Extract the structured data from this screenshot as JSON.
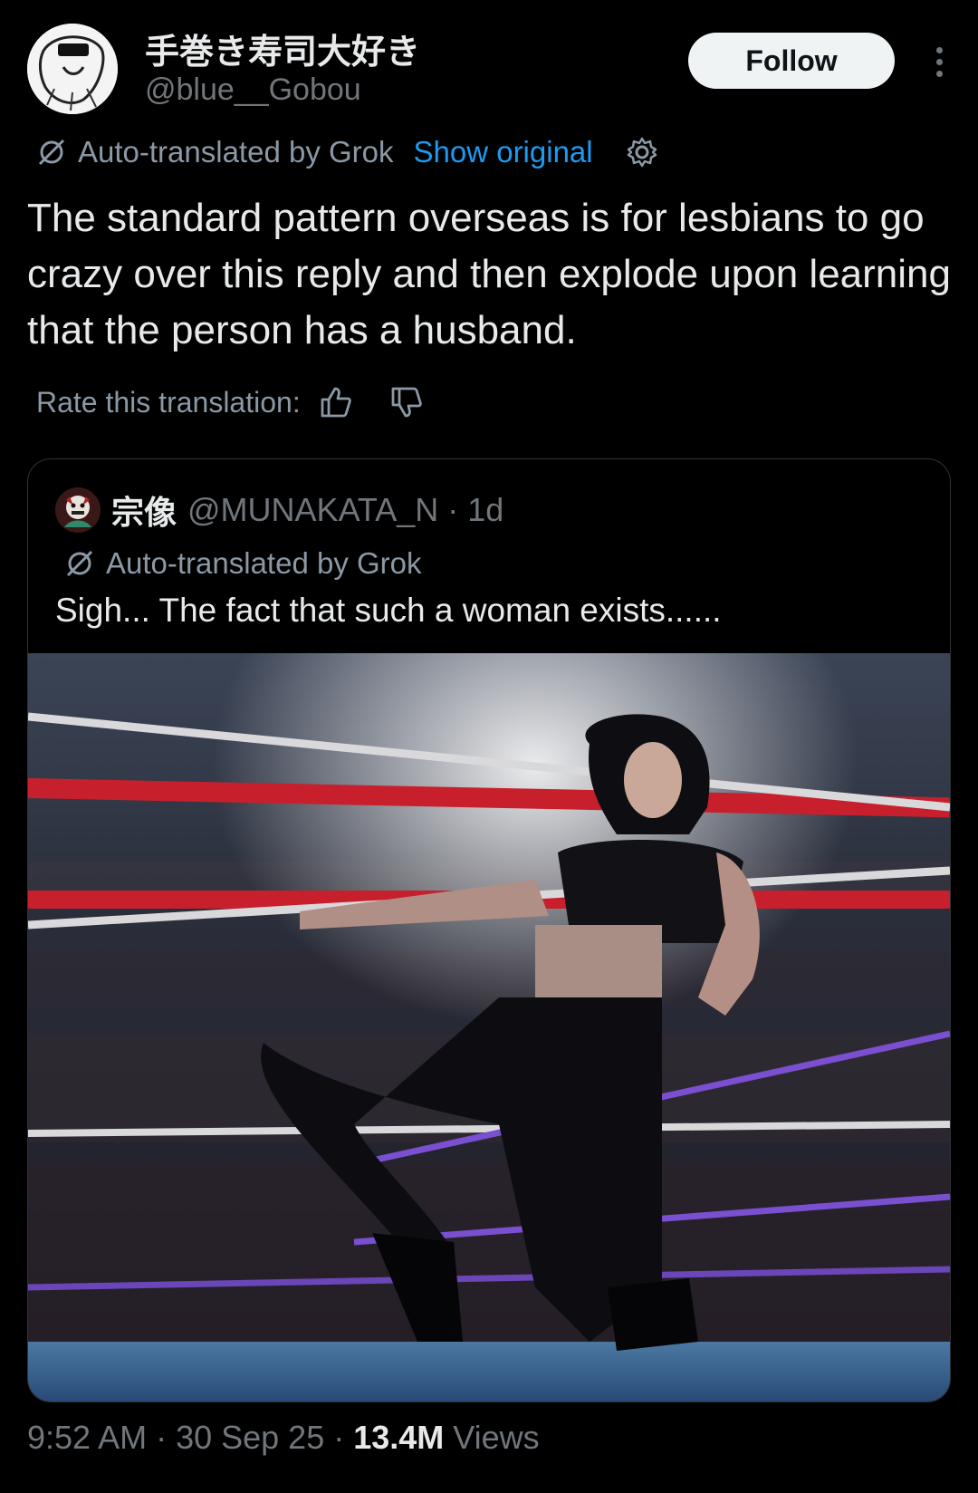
{
  "author": {
    "display_name": "手巻き寿司大好き",
    "handle": "@blue__Gobou"
  },
  "actions": {
    "follow_label": "Follow"
  },
  "translation": {
    "label": "Auto-translated by Grok",
    "show_original": "Show original"
  },
  "tweet": {
    "text": "The standard pattern overseas is for lesbians to go crazy over this reply and then explode upon learning that the person has a husband."
  },
  "rating": {
    "label": "Rate this translation:"
  },
  "quoted_tweet": {
    "display_name": "宗像",
    "handle": "@MUNAKATA_N · 1d",
    "translation_label": "Auto-translated by Grok",
    "text": "Sigh... The fact that such a woman exists......"
  },
  "meta": {
    "time_date": "9:52 AM · 30 Sep 25 · ",
    "views_count": "13.4M",
    "views_label": " Views"
  }
}
